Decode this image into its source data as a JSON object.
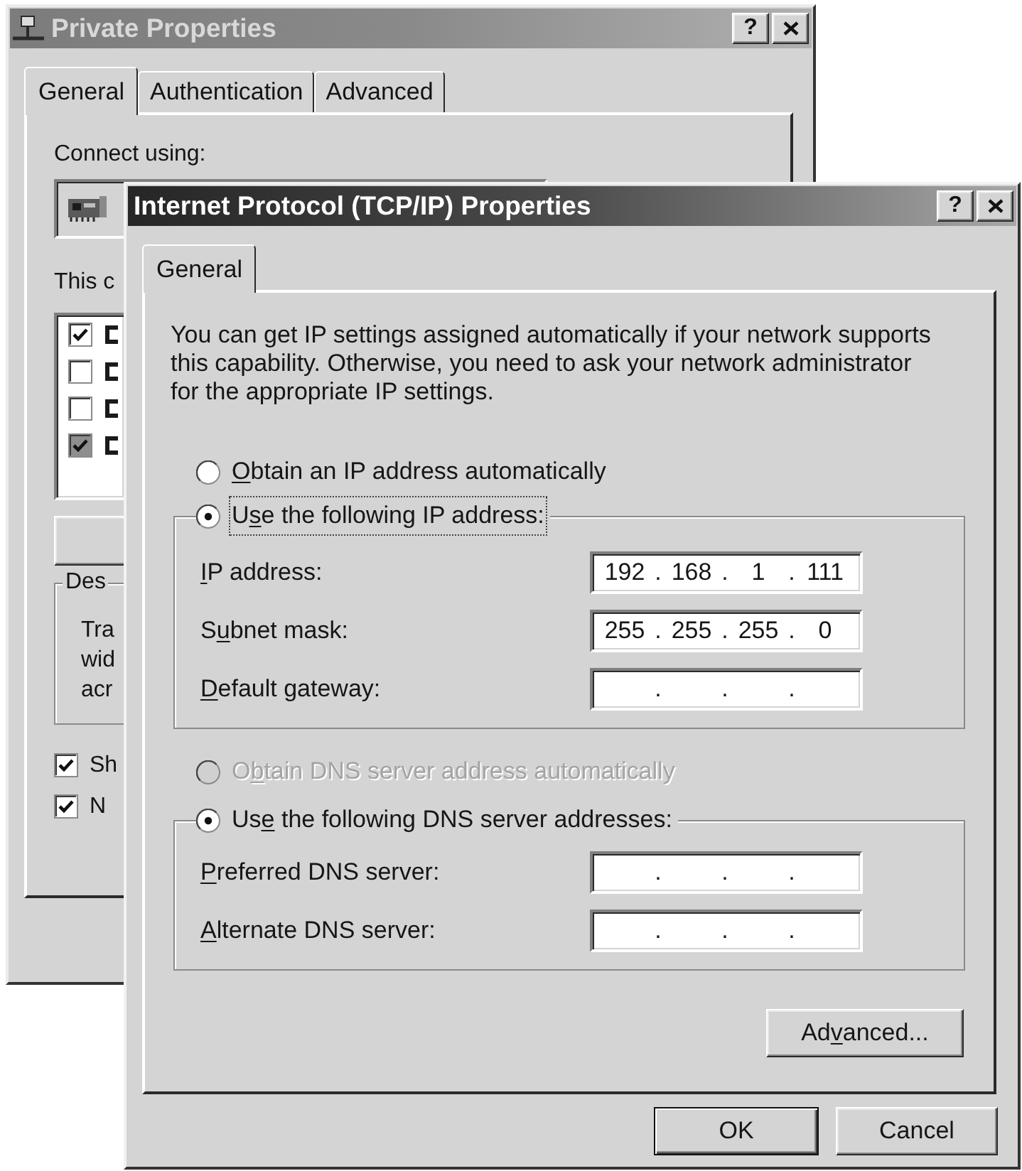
{
  "background_window": {
    "active": false,
    "title": "Private Properties",
    "help_button": "?",
    "tabs": [
      {
        "label": "General",
        "selected": true
      },
      {
        "label": "Authentication",
        "selected": false
      },
      {
        "label": "Advanced",
        "selected": false
      }
    ],
    "connect_using_label": "Connect using:",
    "components_label": "This c",
    "components": [
      {
        "checked": true,
        "disabled": false
      },
      {
        "checked": false,
        "disabled": false
      },
      {
        "checked": false,
        "disabled": false
      },
      {
        "checked": true,
        "disabled": true
      }
    ],
    "description_legend": "Des",
    "description_lines": [
      "Tra",
      "wid",
      "acr"
    ],
    "options": [
      {
        "label": "Sh",
        "checked": true
      },
      {
        "label": "N",
        "checked": true
      }
    ]
  },
  "dialog": {
    "active": true,
    "title": "Internet Protocol (TCP/IP) Properties",
    "help_button": "?",
    "tabs": [
      {
        "label": "General",
        "selected": true
      }
    ],
    "intro": "You can get IP settings assigned automatically if your network supports this capability. Otherwise, you need to ask your network administrator for the appropriate IP settings.",
    "ip_options": [
      {
        "label_parts": [
          {
            "text": "O",
            "underlined": true
          },
          {
            "text": "btain an IP address automatically",
            "underlined": false
          }
        ],
        "selected": false,
        "disabled": false,
        "focused": false
      },
      {
        "label_parts": [
          {
            "text": "U",
            "underlined": false
          },
          {
            "text": "s",
            "underlined": true
          },
          {
            "text": "e the following IP address:",
            "underlined": false
          }
        ],
        "selected": true,
        "disabled": false,
        "focused": true
      }
    ],
    "ip_fields": [
      {
        "label_parts": [
          {
            "text": "I",
            "underlined": true
          },
          {
            "text": "P address:",
            "underlined": false
          }
        ],
        "octets": [
          "192",
          "168",
          "1",
          "111"
        ],
        "separators": [
          ".",
          ".",
          "."
        ]
      },
      {
        "label_parts": [
          {
            "text": "S",
            "underlined": false
          },
          {
            "text": "u",
            "underlined": true
          },
          {
            "text": "bnet mask:",
            "underlined": false
          }
        ],
        "octets": [
          "255",
          "255",
          "255",
          "0"
        ],
        "separators": [
          ".",
          ".",
          "."
        ]
      },
      {
        "label_parts": [
          {
            "text": "D",
            "underlined": true
          },
          {
            "text": "efault gateway:",
            "underlined": false
          }
        ],
        "separators": [
          ".",
          ".",
          "."
        ]
      }
    ],
    "dns_options": [
      {
        "label_parts": [
          {
            "text": "O",
            "underlined": false
          },
          {
            "text": "b",
            "underlined": true
          },
          {
            "text": "tain DNS server address automatically",
            "underlined": false
          }
        ],
        "selected": false,
        "disabled": true,
        "focused": false
      },
      {
        "label_parts": [
          {
            "text": "Us",
            "underlined": false
          },
          {
            "text": "e",
            "underlined": true
          },
          {
            "text": " the following DNS server addresses:",
            "underlined": false
          }
        ],
        "selected": true,
        "disabled": false,
        "focused": false
      }
    ],
    "dns_fields": [
      {
        "label_parts": [
          {
            "text": "P",
            "underlined": true
          },
          {
            "text": "referred DNS server:",
            "underlined": false
          }
        ],
        "separators": [
          ".",
          ".",
          "."
        ]
      },
      {
        "label_parts": [
          {
            "text": "A",
            "underlined": true
          },
          {
            "text": "lternate DNS server:",
            "underlined": false
          }
        ],
        "separators": [
          ".",
          ".",
          "."
        ]
      }
    ],
    "advanced_button": {
      "label_parts": [
        {
          "text": "Ad",
          "underlined": false
        },
        {
          "text": "v",
          "underlined": true
        },
        {
          "text": "anced...",
          "underlined": false
        }
      ]
    },
    "buttons": [
      {
        "label": "OK",
        "default": true
      },
      {
        "label": "Cancel",
        "default": false
      }
    ]
  }
}
